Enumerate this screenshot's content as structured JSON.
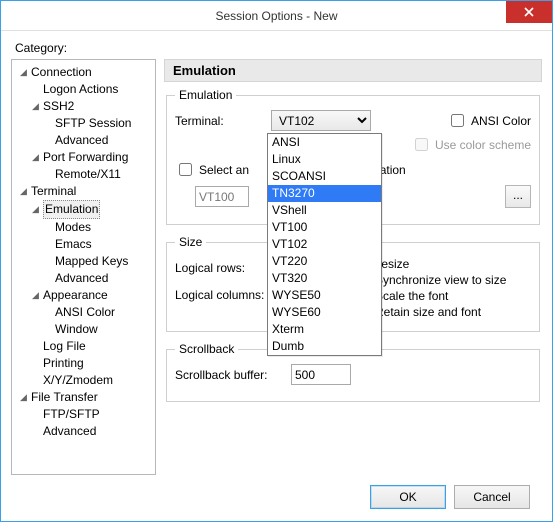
{
  "window": {
    "title": "Session Options - New"
  },
  "category_label": "Category:",
  "tree": {
    "connection": "Connection",
    "logon": "Logon Actions",
    "ssh2": "SSH2",
    "sftp": "SFTP Session",
    "adv1": "Advanced",
    "portfwd": "Port Forwarding",
    "remote": "Remote/X11",
    "terminal": "Terminal",
    "emulation": "Emulation",
    "modes": "Modes",
    "emacs": "Emacs",
    "mapped": "Mapped Keys",
    "adv2": "Advanced",
    "appearance": "Appearance",
    "ansic": "ANSI Color",
    "win": "Window",
    "logfile": "Log File",
    "printing": "Printing",
    "xyz": "X/Y/Zmodem",
    "ft": "File Transfer",
    "ftps": "FTP/SFTP",
    "adv3": "Advanced"
  },
  "section_title": "Emulation",
  "emu": {
    "legend": "Emulation",
    "terminal_label": "Terminal:",
    "terminal_value": "VT102",
    "ansi_color": "ANSI Color",
    "use_scheme": "Use color scheme",
    "select_alt": "Select an alternate keyboard emulation",
    "select_alt_clip": "Select an",
    "select_alt_clip2": "lation",
    "alt_value": "VT100",
    "dots": "..."
  },
  "size": {
    "legend": "Size",
    "rows_label": "Logical rows:",
    "cols_label": "Logical columns:",
    "resize": "On resize",
    "r1": "Synchronize view to size",
    "r2": "Scale the font",
    "r3": "Retain size and font"
  },
  "scrollback": {
    "legend": "Scrollback",
    "label": "Scrollback buffer:",
    "value": "500"
  },
  "dropdown": [
    "ANSI",
    "Linux",
    "SCOANSI",
    "TN3270",
    "VShell",
    "VT100",
    "VT102",
    "VT220",
    "VT320",
    "WYSE50",
    "WYSE60",
    "Xterm",
    "Dumb"
  ],
  "dropdown_selected": "TN3270",
  "buttons": {
    "ok": "OK",
    "cancel": "Cancel"
  }
}
